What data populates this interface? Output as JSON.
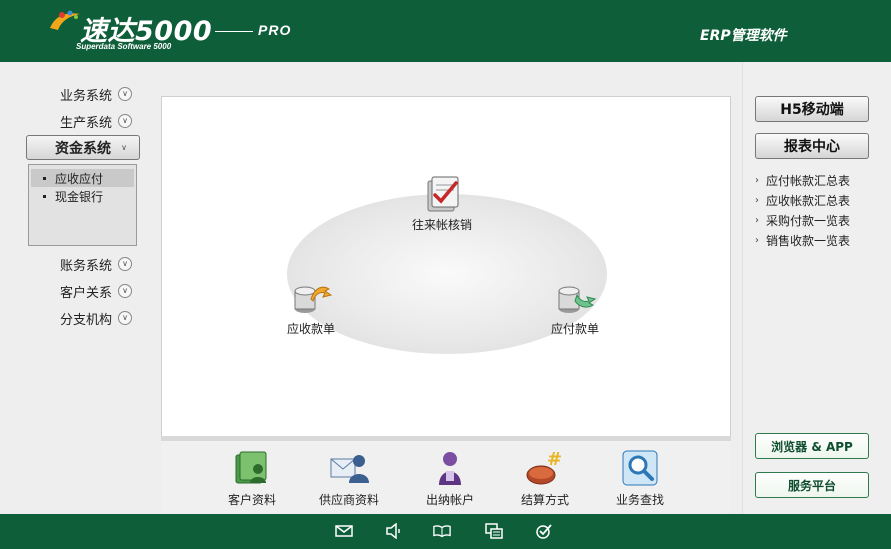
{
  "header": {
    "title": "速达5000",
    "subtitle": "Superdata Software 5000",
    "edition": "PRO",
    "right_text": "ERP管理软件"
  },
  "nav": {
    "items_top": [
      {
        "label": "业务系统"
      },
      {
        "label": "生产系统"
      }
    ],
    "active": {
      "label": "资金系统"
    },
    "submenu": [
      {
        "label": "应收应付",
        "selected": true
      },
      {
        "label": "现金银行",
        "selected": false
      }
    ],
    "items_bottom": [
      {
        "label": "账务系统"
      },
      {
        "label": "客户关系"
      },
      {
        "label": "分支机构"
      }
    ]
  },
  "flow": {
    "top": {
      "label": "往来帐核销",
      "icon": "checklist-icon"
    },
    "left": {
      "label": "应收款单",
      "icon": "receivable-icon"
    },
    "right": {
      "label": "应付款单",
      "icon": "payable-icon"
    }
  },
  "bottom_shortcuts": [
    {
      "label": "客户资料",
      "icon": "customer-icon"
    },
    {
      "label": "供应商资料",
      "icon": "supplier-icon"
    },
    {
      "label": "出纳帐户",
      "icon": "cashier-icon"
    },
    {
      "label": "结算方式",
      "icon": "settlement-icon"
    },
    {
      "label": "业务查找",
      "icon": "magnifier-icon"
    }
  ],
  "right_panel": {
    "mobile_button": "H5移动端",
    "report_button": "报表中心",
    "reports": [
      "应付帐款汇总表",
      "应收帐款汇总表",
      "采购付款一览表",
      "销售收款一览表"
    ],
    "browser_button": "浏览器 & APP",
    "service_button": "服务平台"
  },
  "footer_icons": [
    "mail-icon",
    "speaker-icon",
    "book-icon",
    "windows-icon",
    "check-circle-icon"
  ],
  "colors": {
    "brand_green": "#0e5e3a",
    "panel_bg": "#eeeeee"
  }
}
